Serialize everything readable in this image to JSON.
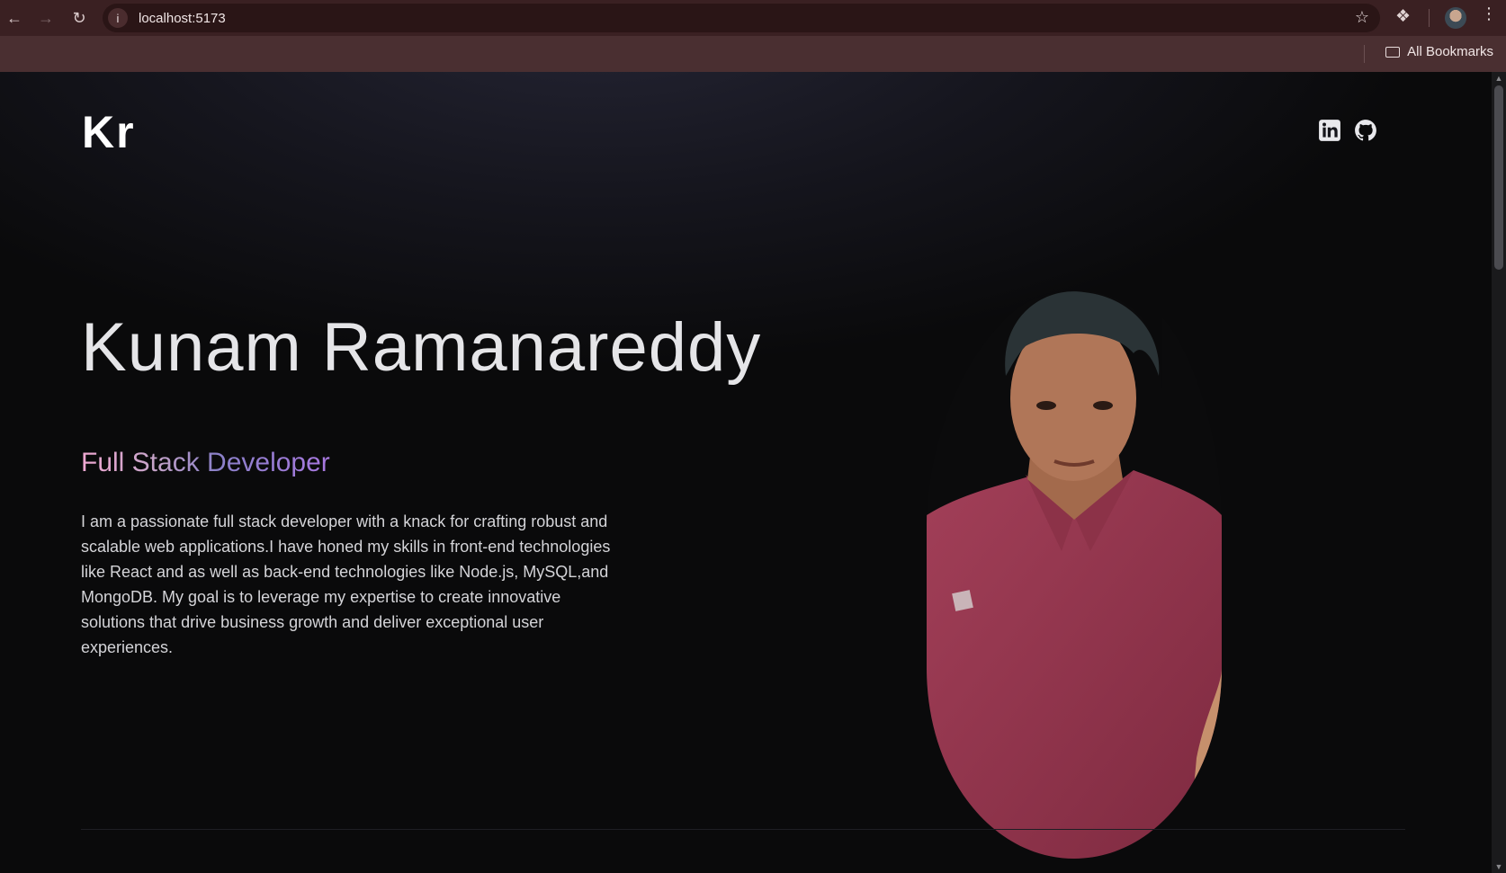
{
  "browser": {
    "url": "localhost:5173",
    "bookmarks_label": "All Bookmarks"
  },
  "site": {
    "logo": "Kr",
    "social": {
      "linkedin": "linkedin-icon",
      "github": "github-icon"
    }
  },
  "hero": {
    "name": "Kunam Ramanareddy",
    "role": "Full Stack Developer",
    "bio": "I am a passionate full stack developer with a knack for crafting robust and scalable web applications.I have honed my skills in front-end technologies like React and as well as back-end technologies like Node.js, MySQL,and MongoDB. My goal is to leverage my expertise to create innovative solutions that drive business growth and deliver exceptional user experiences."
  },
  "colors": {
    "chrome": "#3a2022",
    "bookmarks_bar": "#4a2f31",
    "page_bg": "#0a0a0b",
    "role_gradient_start": "#f0a8d2",
    "role_gradient_end": "#a878e0",
    "shirt": "#9a3a52"
  }
}
